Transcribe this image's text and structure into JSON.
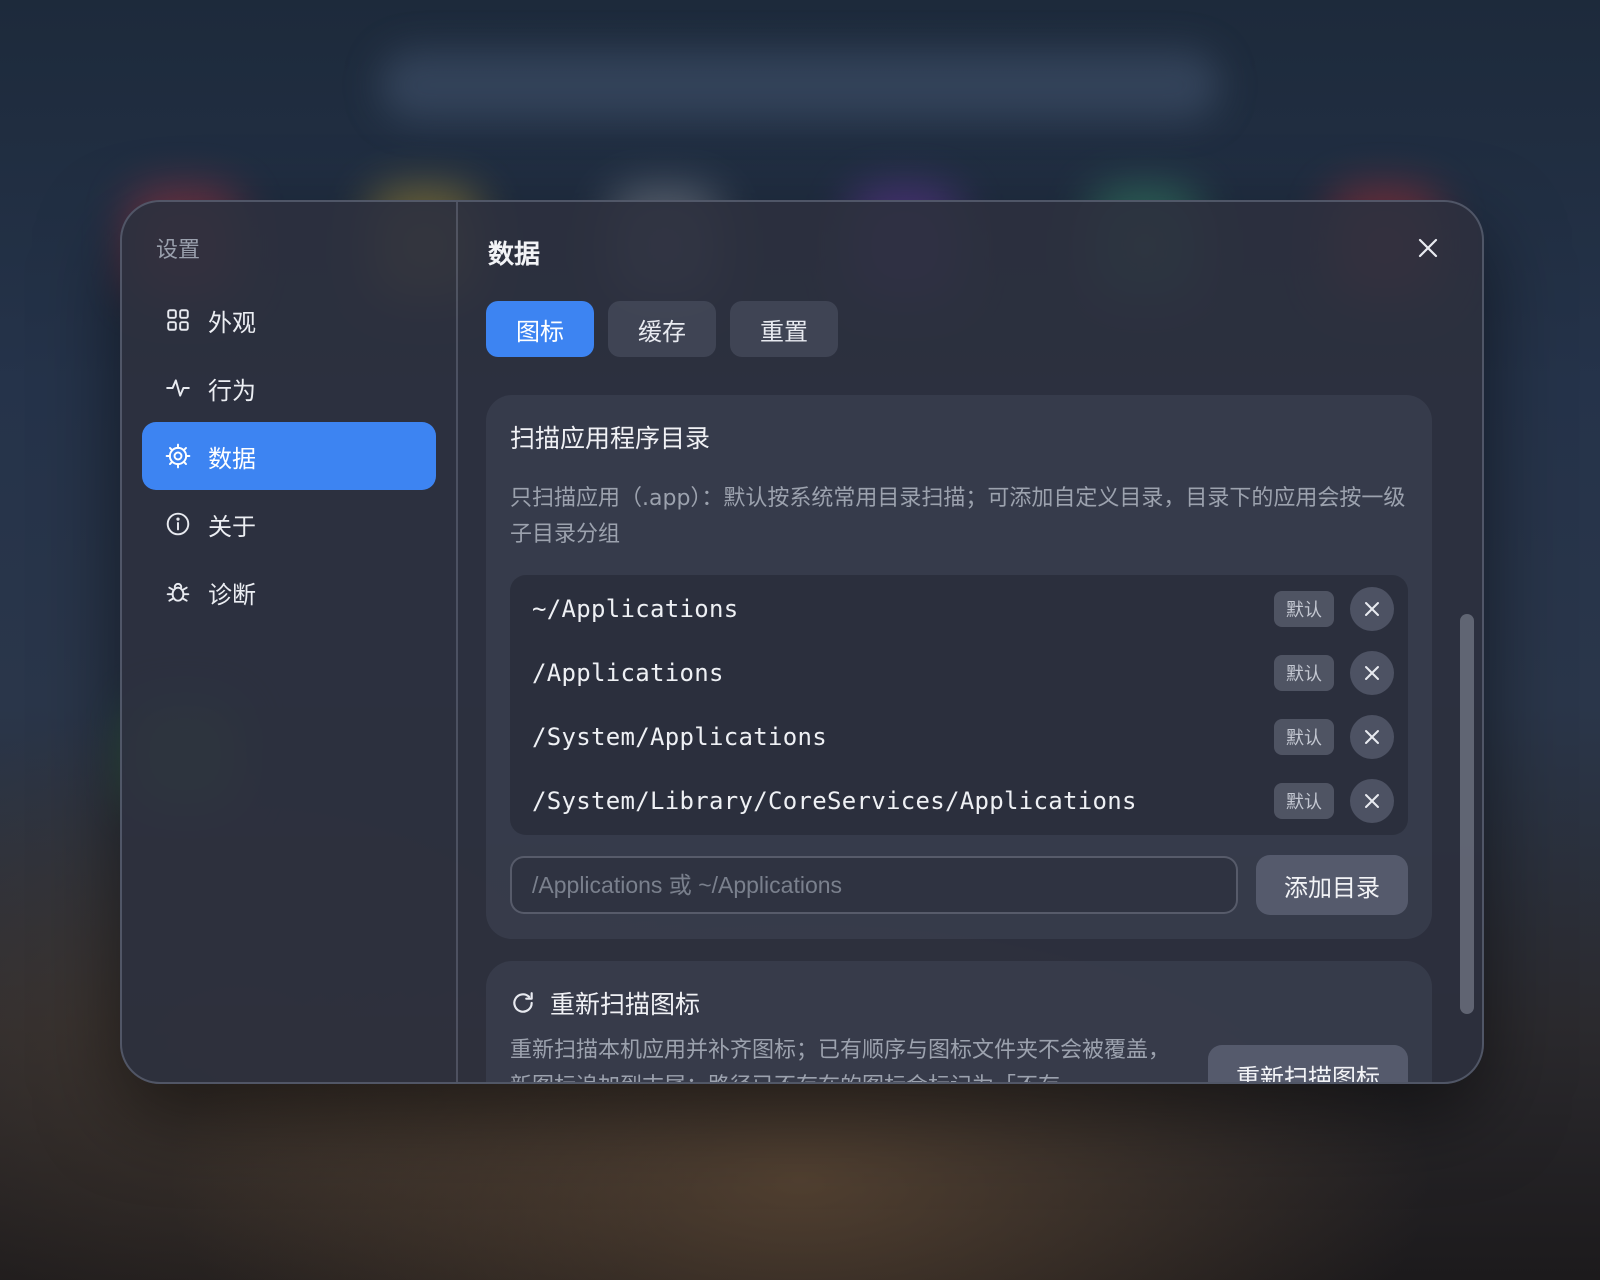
{
  "sidebar": {
    "title": "设置",
    "items": [
      {
        "label": "外观",
        "icon": "grid-icon",
        "active": false
      },
      {
        "label": "行为",
        "icon": "activity-icon",
        "active": false
      },
      {
        "label": "数据",
        "icon": "gear-icon",
        "active": true
      },
      {
        "label": "关于",
        "icon": "info-icon",
        "active": false
      },
      {
        "label": "诊断",
        "icon": "bug-icon",
        "active": false
      }
    ]
  },
  "main": {
    "title": "数据",
    "tabs": [
      {
        "label": "图标",
        "active": true
      },
      {
        "label": "缓存",
        "active": false
      },
      {
        "label": "重置",
        "active": false
      }
    ],
    "scan_card": {
      "title": "扫描应用程序目录",
      "description": "只扫描应用（.app）：默认按系统常用目录扫描；可添加自定义目录，目录下的应用会按一级子目录分组",
      "directories": [
        {
          "path": "~/Applications",
          "badge": "默认"
        },
        {
          "path": "/Applications",
          "badge": "默认"
        },
        {
          "path": "/System/Applications",
          "badge": "默认"
        },
        {
          "path": "/System/Library/CoreServices/Applications",
          "badge": "默认"
        }
      ],
      "input_placeholder": "/Applications 或 ~/Applications",
      "input_value": "",
      "add_button": "添加目录"
    },
    "rescan_card": {
      "title": "重新扫描图标",
      "description": "重新扫描本机应用并补齐图标；已有顺序与图标文件夹不会被覆盖，新图标追加到末尾；路径已不存在的图标会标记为「不存",
      "button": "重新扫描图标"
    }
  },
  "colors": {
    "accent": "#3d84f2"
  }
}
